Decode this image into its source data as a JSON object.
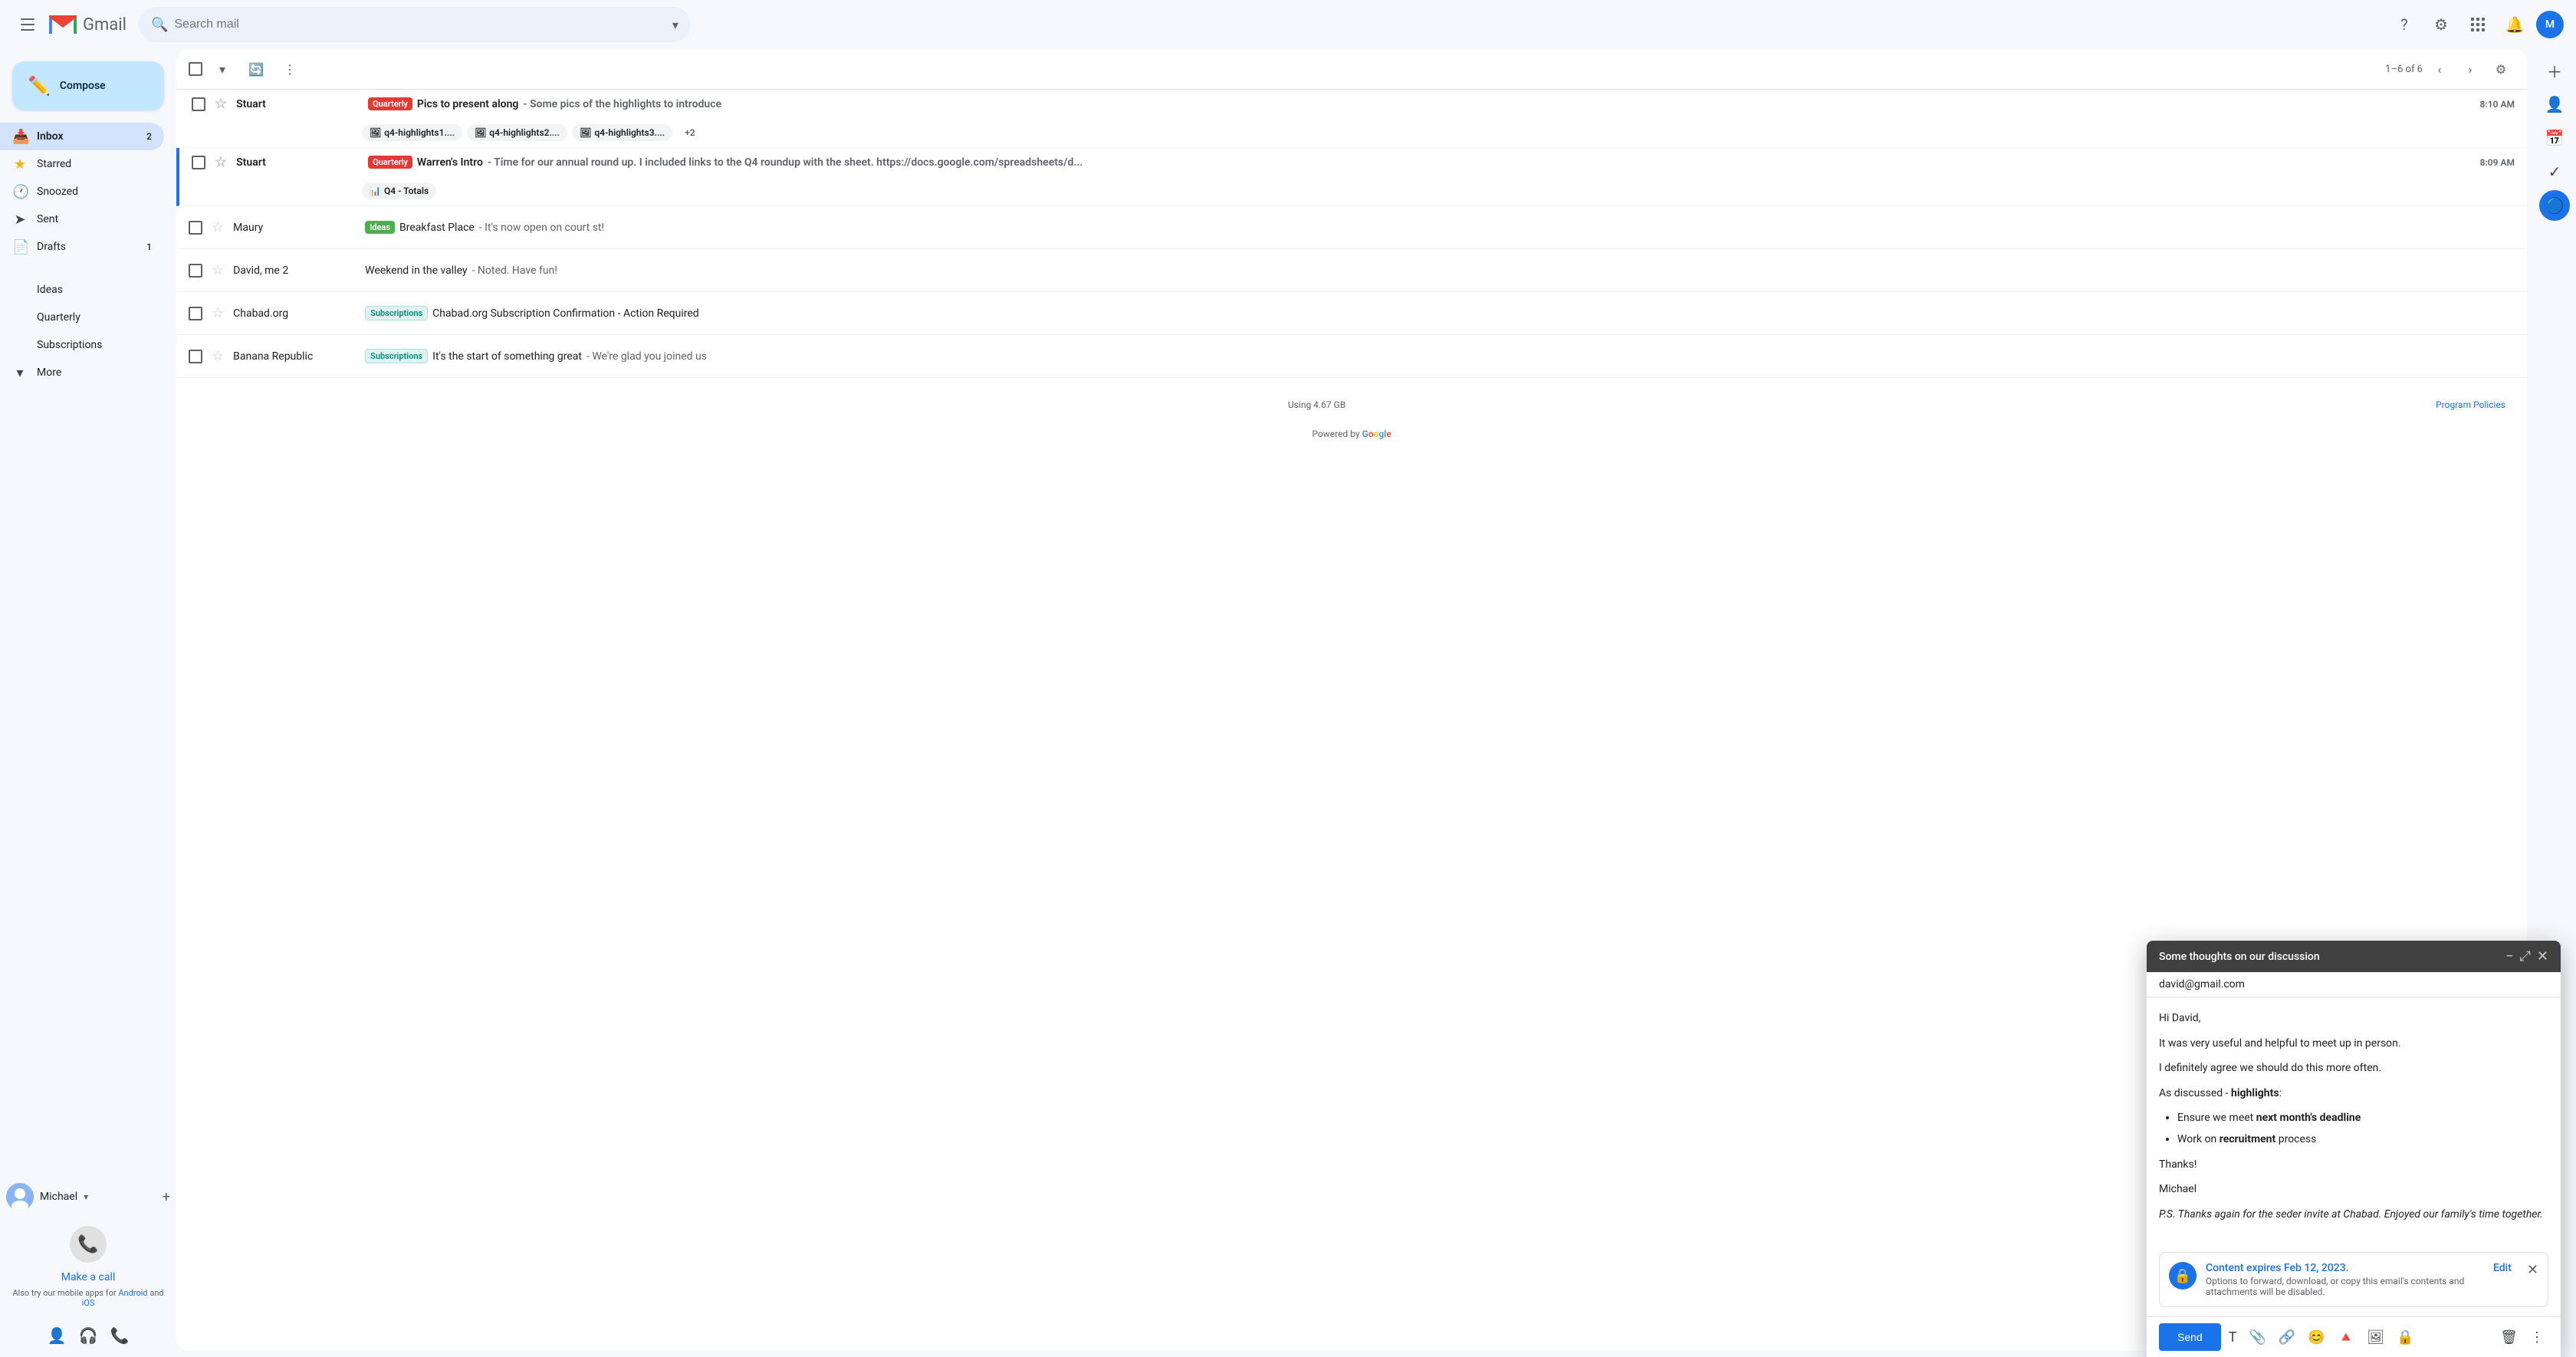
{
  "app": {
    "title": "Gmail",
    "logo_m": "M",
    "logo_text": "Gmail"
  },
  "search": {
    "placeholder": "Search mail"
  },
  "compose": {
    "label": "Compose",
    "plus_icon": "+"
  },
  "nav": {
    "items": [
      {
        "id": "inbox",
        "label": "Inbox",
        "icon": "📥",
        "badge": "2",
        "active": true
      },
      {
        "id": "starred",
        "label": "Starred",
        "icon": "★",
        "badge": ""
      },
      {
        "id": "snoozed",
        "label": "Snoozed",
        "icon": "🕐",
        "badge": ""
      },
      {
        "id": "sent",
        "label": "Sent",
        "icon": "➤",
        "badge": ""
      },
      {
        "id": "drafts",
        "label": "Drafts",
        "icon": "📄",
        "badge": "1"
      },
      {
        "id": "ideas",
        "label": "Ideas",
        "icon": "●",
        "dot_color": "#34A853",
        "badge": ""
      },
      {
        "id": "quarterly",
        "label": "Quarterly",
        "icon": "●",
        "dot_color": "#EA4335",
        "badge": ""
      },
      {
        "id": "subscriptions",
        "label": "Subscriptions",
        "icon": "●",
        "dot_color": "#4285F4",
        "badge": ""
      },
      {
        "id": "more",
        "label": "More",
        "icon": "▾",
        "badge": ""
      }
    ]
  },
  "sidebar_bottom": {
    "user": {
      "name": "Michael",
      "arrow": "▾"
    },
    "phone": {
      "icon": "📞",
      "make_call_label": "Make a call",
      "mobile_text": "Also try our mobile apps for",
      "android_label": "Android",
      "and_label": "and",
      "ios_label": "iOS"
    },
    "bottom_icons": [
      "👤",
      "🎧",
      "📞"
    ]
  },
  "email_list": {
    "header": {
      "checkbox_label": "Select",
      "refresh_icon": "🔄",
      "more_icon": "⋮",
      "pagination": "1–6 of 6",
      "prev_icon": "‹",
      "next_icon": "›",
      "settings_icon": "⚙"
    },
    "emails": [
      {
        "id": "1",
        "sender": "Stuart",
        "label": "Quarterly",
        "label_type": "quarterly",
        "subject": "Pics to present along",
        "snippet": "Some pics of the highlights to introduce",
        "time": "8:10 AM",
        "unread": true,
        "attachments": [
          "q4-highlights1....",
          "q4-highlights2....",
          "q4-highlights3...."
        ],
        "attachment_extra": "+2"
      },
      {
        "id": "2",
        "sender": "Stuart",
        "label": "Quarterly",
        "label_type": "quarterly",
        "subject": "Warren's Intro",
        "snippet": "Time for our annual round up. I included links to the Q4 roundup with the sheet. https://docs.google.com/spreadsheets/d...",
        "time": "8:09 AM",
        "unread": true,
        "attachments": [
          "Q4 - Totals"
        ],
        "sheet_attachment": true
      },
      {
        "id": "3",
        "sender": "Maury",
        "label": "Ideas",
        "label_type": "ideas",
        "subject": "Breakfast Place",
        "snippet": "It's now open on court st!",
        "time": "",
        "unread": false,
        "attachments": []
      },
      {
        "id": "4",
        "sender": "David, me 2",
        "label": "",
        "label_type": "",
        "subject": "Weekend in the valley",
        "snippet": "Noted. Have fun!",
        "time": "",
        "unread": false,
        "attachments": []
      },
      {
        "id": "5",
        "sender": "Chabad.org",
        "label": "Subscriptions",
        "label_type": "subscriptions",
        "subject": "Chabad.org Subscription Confirmation - Action Required",
        "snippet": "",
        "time": "",
        "unread": false,
        "attachments": []
      },
      {
        "id": "6",
        "sender": "Banana Republic",
        "label": "Subscriptions",
        "label_type": "subscriptions",
        "subject": "It's the start of something great",
        "snippet": "We're glad you joined us",
        "time": "",
        "unread": false,
        "attachments": []
      }
    ],
    "footer": {
      "storage": "Using 4.67 GB",
      "program_policies": "Program Policies",
      "powered_by": "Powered by",
      "google": "Google"
    }
  },
  "compose_window": {
    "title": "Some thoughts on our discussion",
    "minimize_icon": "−",
    "maximize_icon": "⤢",
    "close_icon": "✕",
    "to": "david@gmail.com",
    "subject": "Some thoughts on our discussion",
    "body": {
      "greeting": "Hi David,",
      "para1": "It was very useful and helpful to meet up in person.",
      "para2": "I definitely agree we should do this more often.",
      "para3_prefix": "As discussed - ",
      "highlights_label": "highlights",
      "para3_suffix": ":",
      "bullets": [
        {
          "prefix": "Ensure we meet ",
          "bold": "next month's deadline",
          "suffix": ""
        },
        {
          "prefix": "Work on ",
          "bold": "recruitment",
          "suffix": " process"
        }
      ],
      "thanks": "Thanks!",
      "signature": "Michael",
      "ps": "P.S. Thanks again for the seder invite at Chabad. Enjoyed our family's time together."
    },
    "expiry": {
      "icon": "🔒",
      "title": "Content expires Feb 12, 2023.",
      "description": "Options to forward, download, or copy this email's contents and attachments will be disabled.",
      "edit_label": "Edit",
      "close_icon": "✕"
    },
    "send_label": "Send",
    "toolbar_icons": [
      "T",
      "📎",
      "🔗",
      "😊",
      "🔺",
      "🖼",
      "🔒"
    ]
  },
  "right_panel": {
    "icons": [
      "⊕",
      "👤",
      "📅",
      "✓",
      "🔵"
    ]
  }
}
